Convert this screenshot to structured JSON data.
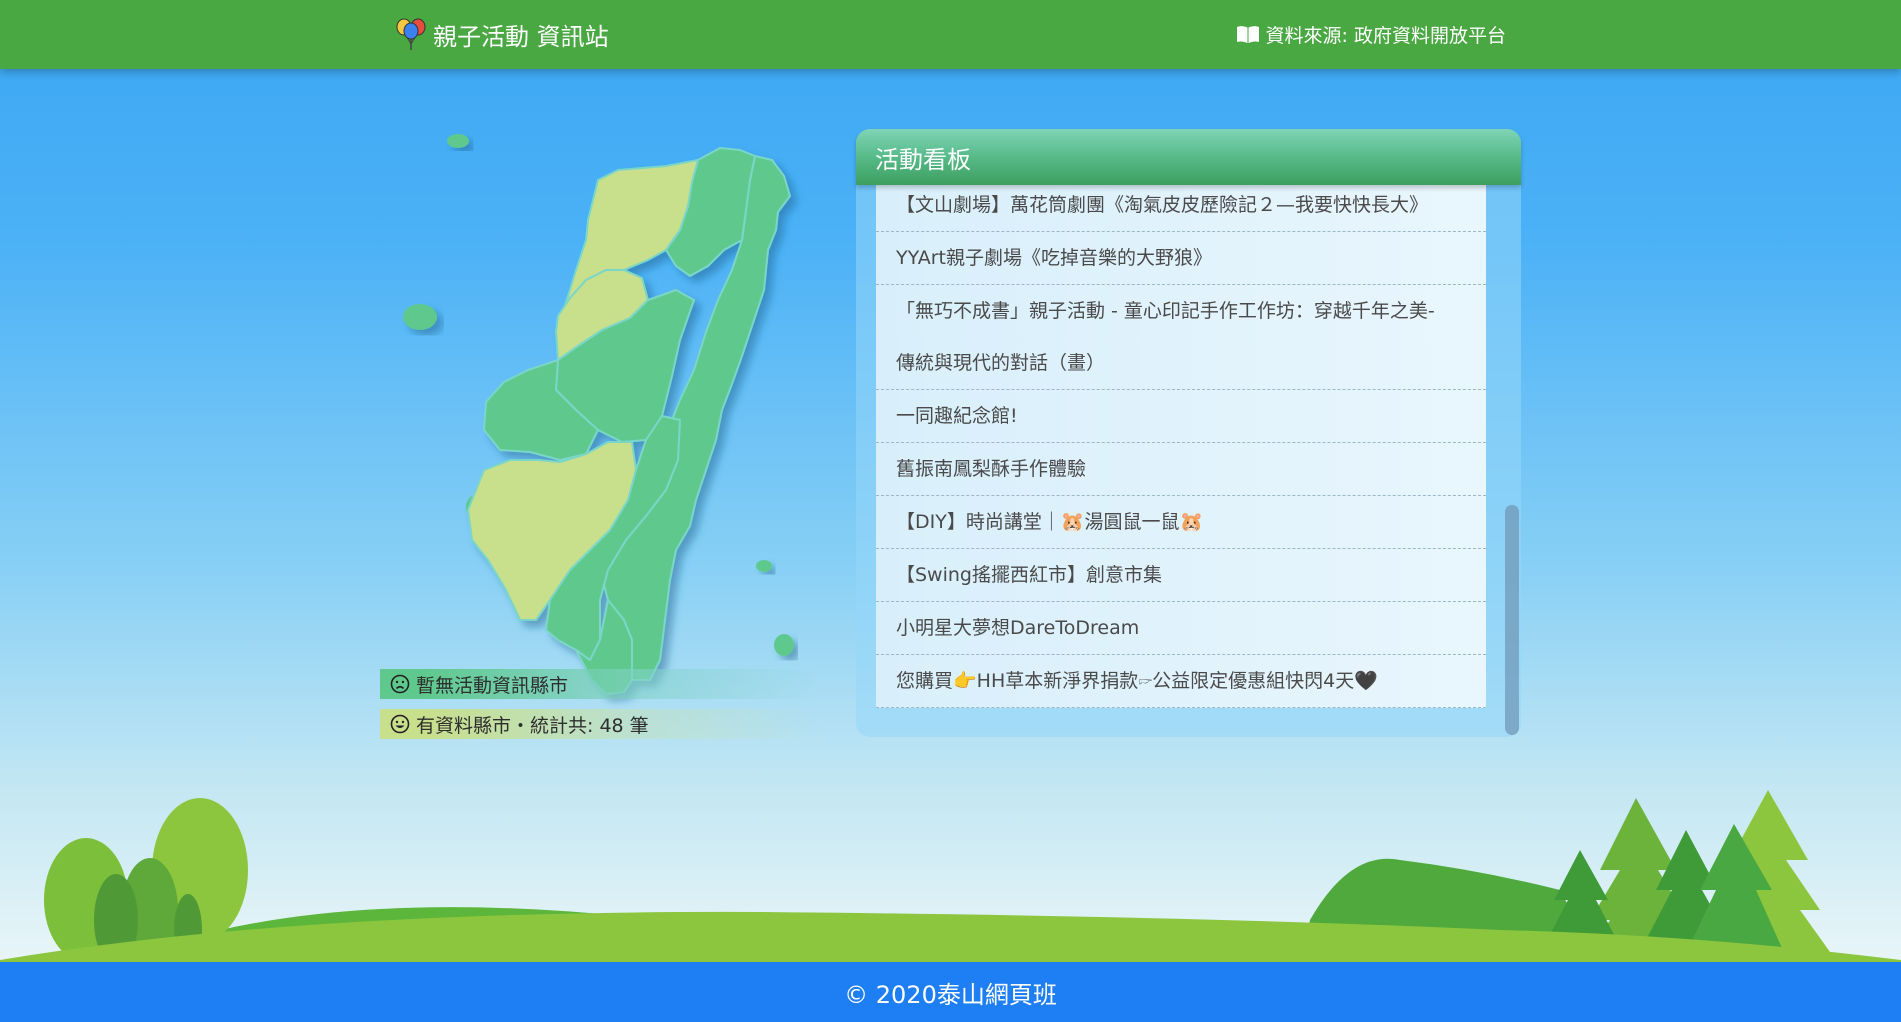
{
  "header": {
    "brand_icon": "balloons-icon",
    "title": "親子活動 資訊站",
    "source_icon": "book-icon",
    "source_text": "資料來源: 政府資料開放平台"
  },
  "legend": {
    "none_icon": "sad-face-icon",
    "none_text": "暫無活動資訊縣市",
    "has_icon": "smile-face-icon",
    "has_text": "有資料縣市・統計共: 48 筆"
  },
  "board": {
    "title": "活動看板",
    "items": [
      "【文山劇場】萬花筒劇團《淘氣皮皮歷險記２—我要快快長大》",
      "YYArt親子劇場《吃掉音樂的大野狼》",
      "「無巧不成書」親子活動 - 童心印記手作工作坊：穿越千年之美-",
      "傳統與現代的對話（畫）",
      "一同趣紀念館!",
      "舊振南鳳梨酥手作體驗",
      "【DIY】時尚講堂｜🐹湯圓鼠一鼠🐹",
      "【Swing搖擺西紅市】創意市集",
      "小明星大夢想DareToDream",
      "您購買👉HH草本新淨界捐款🖙公益限定優惠組快閃4天🖤"
    ]
  },
  "colors": {
    "header_bg": "#4aa843",
    "footer_bg": "#1e7ff5",
    "county_has_data": "#c8df8c",
    "county_no_data": "#5fc98d"
  },
  "footer": {
    "text": "© 2020泰山網頁班"
  }
}
